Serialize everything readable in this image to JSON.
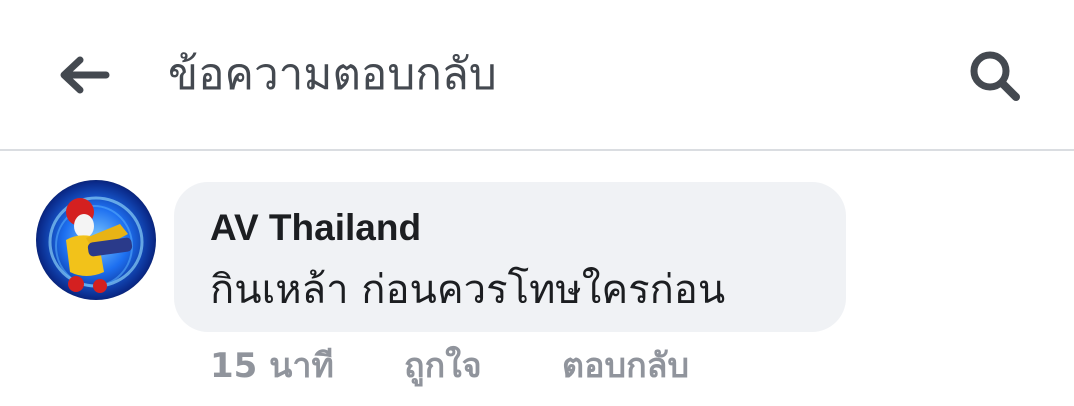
{
  "header": {
    "title": "ข้อความตอบกลับ",
    "back_icon": "arrow-left-icon",
    "search_icon": "search-icon"
  },
  "comment": {
    "avatar_icon": "user-avatar",
    "author": "AV Thailand",
    "text": "กินเหล้า ก่อนควรโทษใครก่อน",
    "timestamp": "15 นาที",
    "like_label": "ถูกใจ",
    "reply_label": "ตอบกลับ"
  },
  "colors": {
    "icon": "#444950",
    "bubble_bg": "#f0f2f5",
    "meta_text": "#90949c",
    "divider": "#dadde1"
  }
}
